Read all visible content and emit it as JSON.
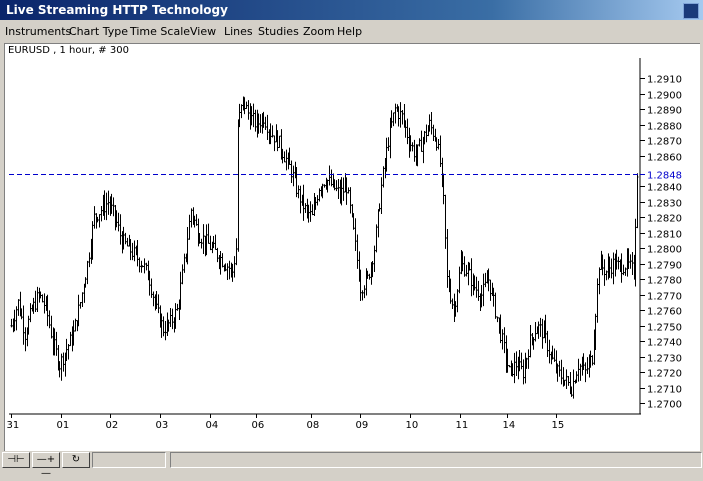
{
  "window": {
    "title": "Live Streaming HTTP Technology"
  },
  "menu": [
    "Instruments",
    "Chart Type",
    "Time Scale",
    "View",
    "Lines",
    "Studies",
    "Zoom",
    "Help"
  ],
  "chart": {
    "symbol_label": "EURUSD , 1 hour, # 300",
    "current_price_label": "1.2848",
    "colors": {
      "bars": "#000000",
      "current_line": "#0000cc",
      "current_label": "#0000cc",
      "background": "#ffffff"
    }
  },
  "chart_data": {
    "type": "ohlc",
    "title": "EURUSD , 1 hour, # 300",
    "ylim": [
      1.2693,
      1.2923
    ],
    "y_ticks": [
      "1.2700",
      "1.2710",
      "1.2720",
      "1.2730",
      "1.2740",
      "1.2750",
      "1.2760",
      "1.2770",
      "1.2780",
      "1.2790",
      "1.2800",
      "1.2810",
      "1.2820",
      "1.2830",
      "1.2840",
      "1.2848",
      "1.2860",
      "1.2870",
      "1.2880",
      "1.2890",
      "1.2900",
      "1.2910"
    ],
    "x_ticks": [
      "31",
      "01",
      "02",
      "03",
      "04",
      "06",
      "08",
      "09",
      "10",
      "11",
      "14",
      "15"
    ],
    "current_price": 1.2848,
    "grid": false,
    "approx_closes": [
      [
        0,
        1.275
      ],
      [
        4,
        1.2765
      ],
      [
        8,
        1.2745
      ],
      [
        12,
        1.276
      ],
      [
        16,
        1.277
      ],
      [
        20,
        1.2762
      ],
      [
        24,
        1.274
      ],
      [
        28,
        1.2725
      ],
      [
        32,
        1.2735
      ],
      [
        36,
        1.2745
      ],
      [
        40,
        1.2765
      ],
      [
        44,
        1.279
      ],
      [
        48,
        1.282
      ],
      [
        52,
        1.2825
      ],
      [
        56,
        1.283
      ],
      [
        60,
        1.282
      ],
      [
        64,
        1.2805
      ],
      [
        68,
        1.28
      ],
      [
        72,
        1.2795
      ],
      [
        76,
        1.279
      ],
      [
        80,
        1.278
      ],
      [
        84,
        1.276
      ],
      [
        88,
        1.2748
      ],
      [
        92,
        1.2752
      ],
      [
        96,
        1.276
      ],
      [
        100,
        1.279
      ],
      [
        104,
        1.2825
      ],
      [
        108,
        1.281
      ],
      [
        112,
        1.2805
      ],
      [
        116,
        1.28
      ],
      [
        120,
        1.2795
      ],
      [
        124,
        1.279
      ],
      [
        128,
        1.2785
      ],
      [
        130,
        1.28
      ],
      [
        131,
        1.288
      ],
      [
        134,
        1.2895
      ],
      [
        138,
        1.2885
      ],
      [
        142,
        1.288
      ],
      [
        146,
        1.2885
      ],
      [
        150,
        1.2875
      ],
      [
        154,
        1.287
      ],
      [
        158,
        1.286
      ],
      [
        162,
        1.285
      ],
      [
        166,
        1.2835
      ],
      [
        170,
        1.2825
      ],
      [
        174,
        1.282
      ],
      [
        178,
        1.284
      ],
      [
        182,
        1.2845
      ],
      [
        186,
        1.284
      ],
      [
        190,
        1.2835
      ],
      [
        194,
        1.284
      ],
      [
        198,
        1.281
      ],
      [
        202,
        1.2775
      ],
      [
        206,
        1.278
      ],
      [
        210,
        1.28
      ],
      [
        214,
        1.284
      ],
      [
        218,
        1.287
      ],
      [
        222,
        1.289
      ],
      [
        226,
        1.2885
      ],
      [
        230,
        1.287
      ],
      [
        234,
        1.286
      ],
      [
        238,
        1.287
      ],
      [
        242,
        1.288
      ],
      [
        246,
        1.287
      ],
      [
        248,
        1.2855
      ],
      [
        250,
        1.283
      ],
      [
        252,
        1.278
      ],
      [
        256,
        1.276
      ],
      [
        260,
        1.279
      ],
      [
        264,
        1.2785
      ],
      [
        268,
        1.2775
      ],
      [
        272,
        1.277
      ],
      [
        276,
        1.278
      ],
      [
        280,
        1.276
      ],
      [
        284,
        1.274
      ],
      [
        288,
        1.272
      ],
      [
        292,
        1.2725
      ],
      [
        296,
        1.272
      ],
      [
        300,
        1.274
      ],
      [
        304,
        1.275
      ],
      [
        308,
        1.2745
      ],
      [
        312,
        1.273
      ],
      [
        316,
        1.272
      ],
      [
        320,
        1.2715
      ],
      [
        324,
        1.271
      ],
      [
        328,
        1.2725
      ],
      [
        332,
        1.272
      ],
      [
        336,
        1.273
      ],
      [
        338,
        1.276
      ],
      [
        340,
        1.279
      ],
      [
        344,
        1.2785
      ],
      [
        348,
        1.279
      ],
      [
        352,
        1.2788
      ],
      [
        356,
        1.279
      ],
      [
        360,
        1.2785
      ],
      [
        362,
        1.285
      ]
    ]
  },
  "statusbar": {
    "buttons": [
      "⊣⊢",
      "—+—",
      "↻"
    ]
  }
}
